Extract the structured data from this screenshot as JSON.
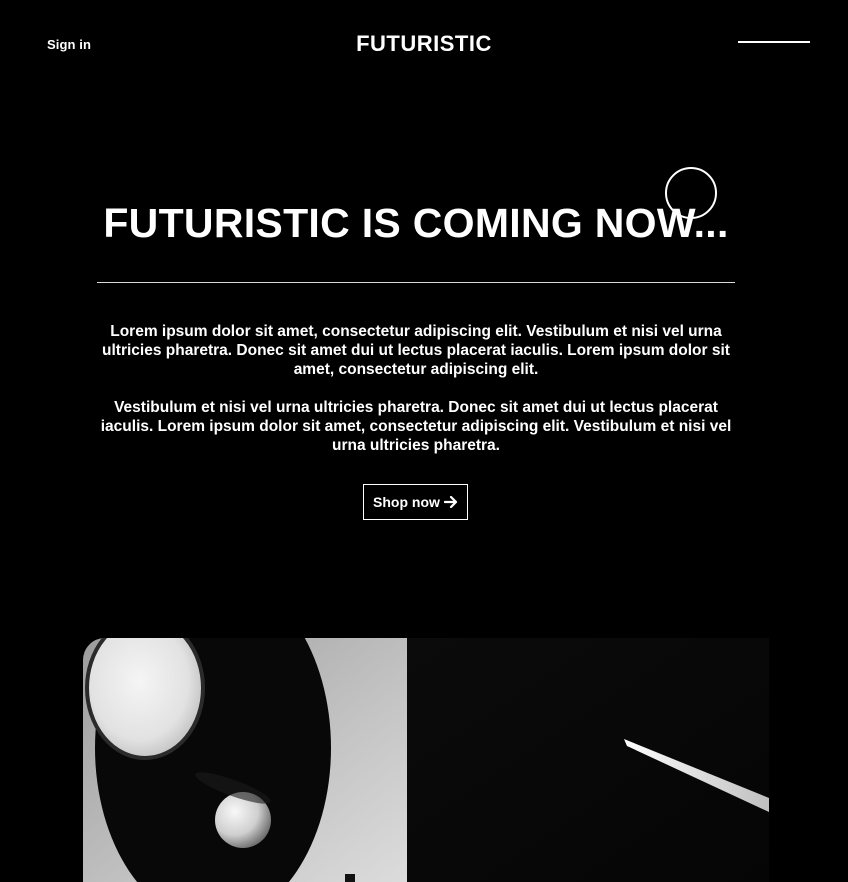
{
  "header": {
    "signin_label": "Sign in",
    "brand": "FUTURISTIC"
  },
  "icons": {
    "menu": "hamburger-line-icon",
    "arrow": "arrow-right-icon"
  },
  "hero": {
    "title": "FUTURISTIC IS COMING NOW...",
    "paragraph1": "Lorem ipsum dolor sit amet, consectetur adipiscing elit. Vestibulum et nisi vel urna ultricies pharetra. Donec sit amet dui ut lectus placerat iaculis. Lorem ipsum dolor sit amet, consectetur adipiscing elit.",
    "paragraph2": "Vestibulum et nisi vel urna ultricies pharetra. Donec sit amet dui ut lectus placerat iaculis. Lorem ipsum dolor sit amet, consectetur adipiscing elit. Vestibulum et nisi vel urna ultricies pharetra.",
    "cta_label": "Shop now"
  },
  "colors": {
    "background": "#000000",
    "text": "#ffffff",
    "divider": "#d9d9d9"
  }
}
